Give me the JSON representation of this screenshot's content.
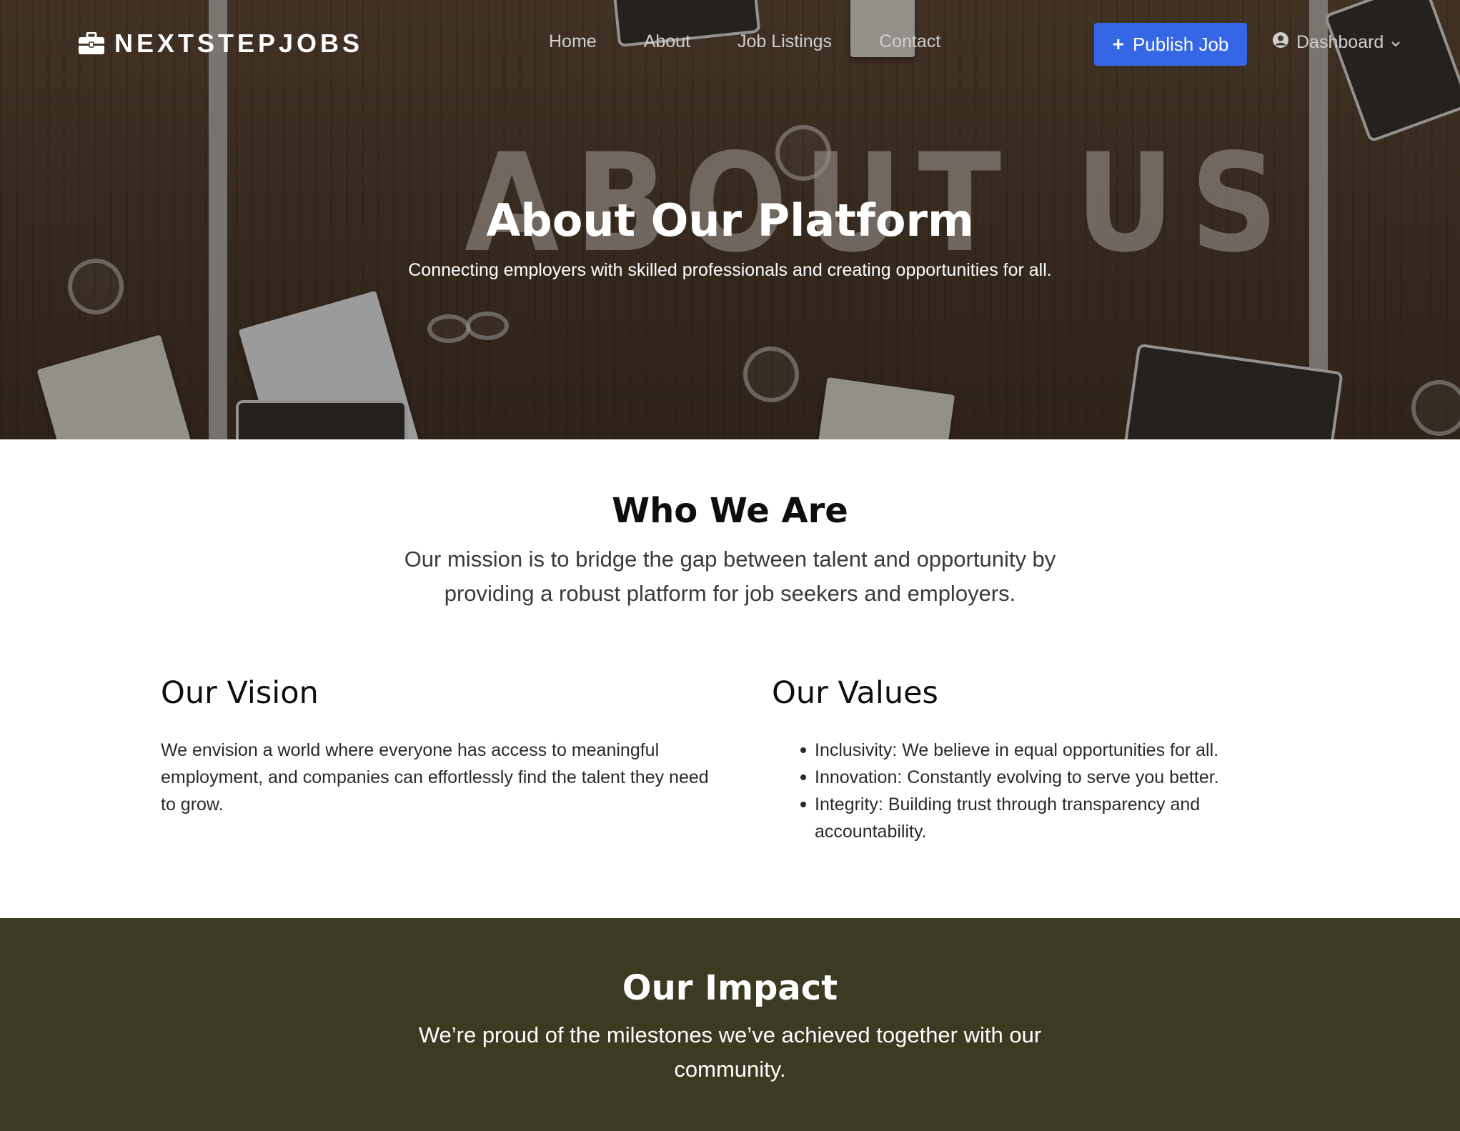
{
  "brand": {
    "name": "NEXTSTEPJOBS",
    "icon": "briefcase-icon"
  },
  "nav": {
    "links": [
      "Home",
      "About",
      "Job Listings",
      "Contact"
    ],
    "publish_label": "Publish Job",
    "publish_icon": "plus-icon",
    "dashboard_label": "Dashboard",
    "dashboard_icon": "user-circle-icon"
  },
  "hero": {
    "background_text": "ABOUT US",
    "title": "About Our Platform",
    "subtitle": "Connecting employers with skilled professionals and creating opportunities for all."
  },
  "who": {
    "title": "Who We Are",
    "text": "Our mission is to bridge the gap between talent and opportunity by providing a robust platform for job seekers and employers.",
    "vision": {
      "title": "Our Vision",
      "text": "We envision a world where everyone has access to meaningful employment, and companies can effortlessly find the talent they need to grow."
    },
    "values": {
      "title": "Our Values",
      "items": [
        "Inclusivity: We believe in equal opportunities for all.",
        "Innovation: Constantly evolving to serve you better.",
        "Integrity: Building trust through transparency and accountability."
      ]
    }
  },
  "impact": {
    "title": "Our Impact",
    "text": "We’re proud of the milestones we’ve achieved together with our community."
  },
  "colors": {
    "accent": "#3566e6",
    "impact_bg": "#3c3b22",
    "hero_bg": "#4b3a2b"
  }
}
